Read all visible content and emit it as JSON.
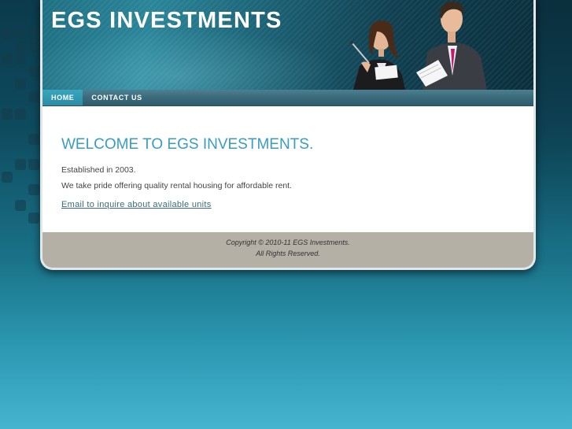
{
  "site": {
    "title": "EGS INVESTMENTS"
  },
  "nav": {
    "items": [
      {
        "label": "HOME",
        "active": true
      },
      {
        "label": "CONTACT US",
        "active": false
      }
    ]
  },
  "main": {
    "heading": "WELCOME TO EGS INVESTMENTS.",
    "paragraphs": [
      "Established in 2003.",
      "We take pride offering quality rental housing for affordable rent."
    ],
    "email_link": "Email to inquire about available units"
  },
  "footer": {
    "copyright": "Copyright © 2010-11 EGS Investments.",
    "rights": "All Rights Reserved."
  },
  "colors": {
    "heading": "#3a9cc0",
    "nav_active": "#3aa6be",
    "footer_bg": "#b4b0a6"
  }
}
